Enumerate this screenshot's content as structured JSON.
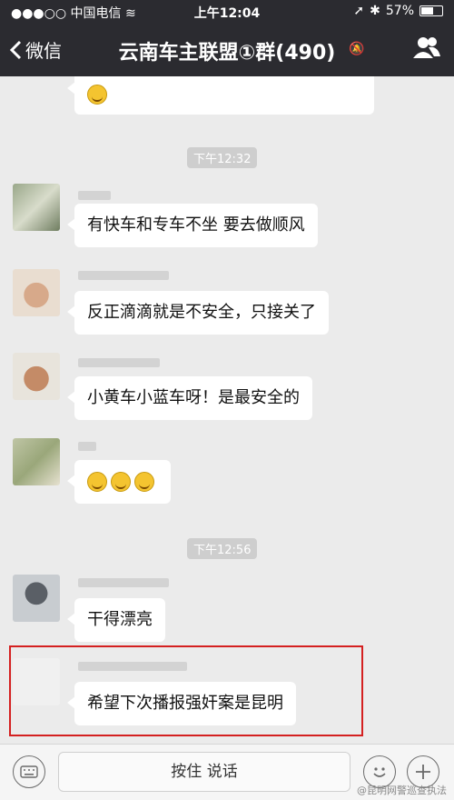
{
  "status_bar": {
    "carrier": "中国电信",
    "time": "上午12:04",
    "battery": "57%",
    "battery_level": 0.57
  },
  "nav": {
    "back_label": "微信",
    "title": "云南车主联盟①群(490)"
  },
  "timestamps": [
    "下午12:32",
    "下午12:56"
  ],
  "messages": [
    {
      "text": "有快车和专车不坐 要去做顺风"
    },
    {
      "text": "反正滴滴就是不安全，只接关了"
    },
    {
      "text": "小黄车小蓝车呀！是最安全的"
    },
    {
      "text": "干得漂亮"
    },
    {
      "text": "希望下次播报强奸案是昆明"
    }
  ],
  "input_bar": {
    "hold_to_talk": "按住 说话"
  },
  "watermark": "@昆明网警巡查执法"
}
